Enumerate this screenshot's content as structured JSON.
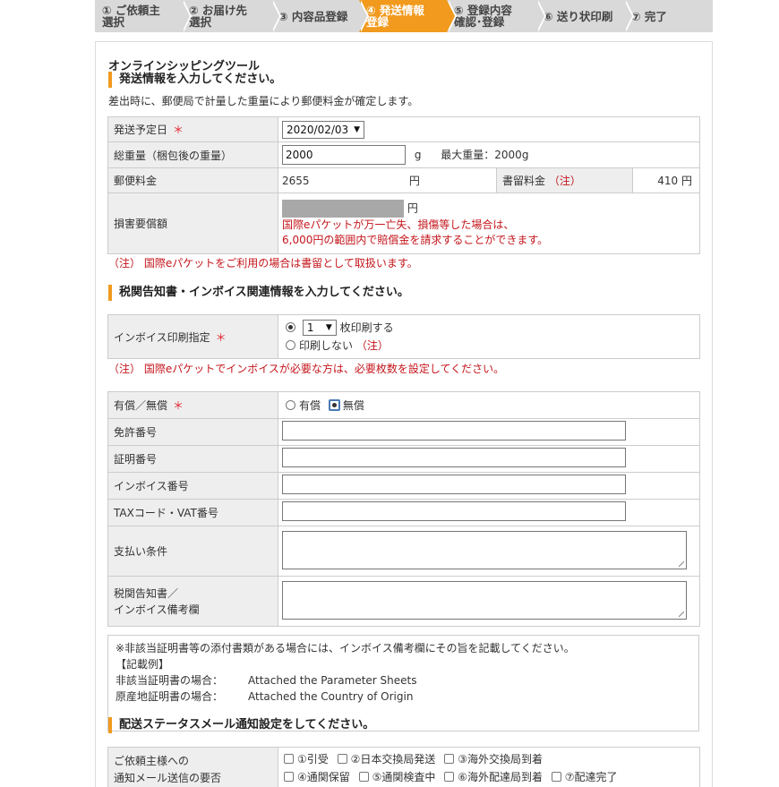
{
  "steps": [
    {
      "label": "① ご依頼主\n選択",
      "active": false
    },
    {
      "label": "② お届け先\n選択",
      "active": false
    },
    {
      "label": "③ 内容品登録",
      "active": false
    },
    {
      "label": "④ 発送情報\n登録",
      "active": true
    },
    {
      "label": "⑤ 登録内容\n確認･登録",
      "active": false
    },
    {
      "label": "⑥ 送り状印刷",
      "active": false
    },
    {
      "label": "⑦ 完了",
      "active": false
    }
  ],
  "tool_title": "オンラインシッピングツール",
  "shipping": {
    "heading": "発送情報を入力してください。",
    "intro": "差出時に、郵便局で計量した重量により郵便料金が確定します。",
    "date_label": "発送予定日",
    "required_mark": "＊",
    "date_value": "2020/02/03",
    "weight_label": "総重量（梱包後の重量）",
    "weight_value": "2000",
    "weight_unit": "g",
    "max_weight": "最大重量：2000g",
    "postage_label": "郵便料金",
    "postage_value": "2655",
    "yen": "円",
    "registered_label": "書留料金",
    "registered_note": "（注）",
    "registered_value": "410 円",
    "damage_label": "損害要償額",
    "damage_note_1": "国際eパケットが万一亡失、損傷等した場合は、",
    "damage_note_2": "6,000円の範囲内で賠償金を請求することができます。",
    "footnote": "（注）  国際eパケットをご利用の場合は書留として取扱います。"
  },
  "customs": {
    "heading": "税関告知書・インボイス関連情報を入力してください。",
    "invoice_label": "インボイス印刷指定",
    "copies_value": "1",
    "print_label": "枚印刷する",
    "no_print_label": "印刷しない",
    "no_print_note": "（注）",
    "footnote": "（注）  国際eパケットでインボイスが必要な方は、必要枚数を設定してください。",
    "paid_label": "有償／無償",
    "paid_option": "有償",
    "free_option": "無償",
    "license_label": "免許番号",
    "certificate_label": "証明番号",
    "invoice_no_label": "インボイス番号",
    "tax_label": "TAXコード・VAT番号",
    "payment_label": "支払い条件",
    "remarks_label_1": "税関告知書／",
    "remarks_label_2": "インボイス備考欄"
  },
  "info": {
    "line1": "※非該当証明書等の添付書類がある場合には、インボイス備考欄にその旨を記載してください。",
    "line2": "【記載例】",
    "line3_key": "非該当証明書の場合：",
    "line3_val": "Attached the Parameter Sheets",
    "line4_key": "原産地証明書の場合：",
    "line4_val": "Attached the Country of Origin"
  },
  "mail": {
    "heading": "配送ステータスメール通知設定をしてください。",
    "label_1": "ご依頼主様への",
    "label_2": "通知メール送信の要否",
    "options_row1": [
      "①引受",
      "②日本交換局発送",
      "③海外交換局到着"
    ],
    "options_row2": [
      "④通関保留",
      "⑤通関検査中",
      "⑥海外配達局到着",
      "⑦配達完了"
    ]
  }
}
